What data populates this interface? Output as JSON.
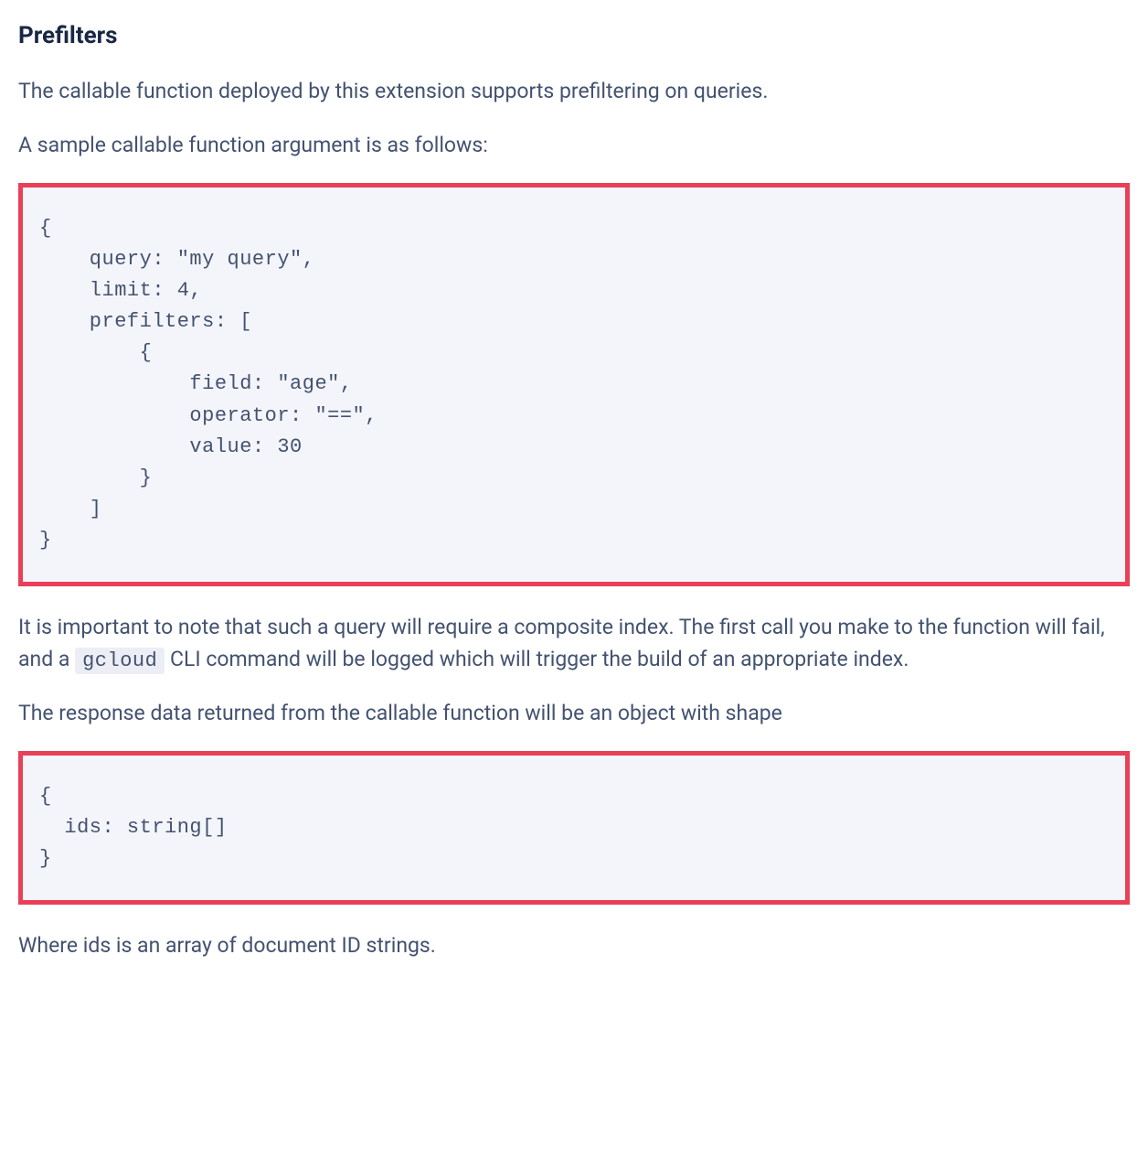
{
  "heading": "Prefilters",
  "para1": "The callable function deployed by this extension supports prefiltering on queries.",
  "para2": "A sample callable function argument is as follows:",
  "code1": "{\n    query: \"my query\",\n    limit: 4,\n    prefilters: [\n        {\n            field: \"age\",\n            operator: \"==\",\n            value: 30\n        }\n    ]\n}",
  "para3_part1": "It is important to note that such a query will require a composite index. The first call you make to the function will fail, and a ",
  "para3_inline": "gcloud",
  "para3_part2": " CLI command will be logged which will trigger the build of an appropriate index.",
  "para4": "The response data returned from the callable function will be an object with shape",
  "code2": "{\n  ids: string[]\n}",
  "para5": "Where ids is an array of document ID strings."
}
